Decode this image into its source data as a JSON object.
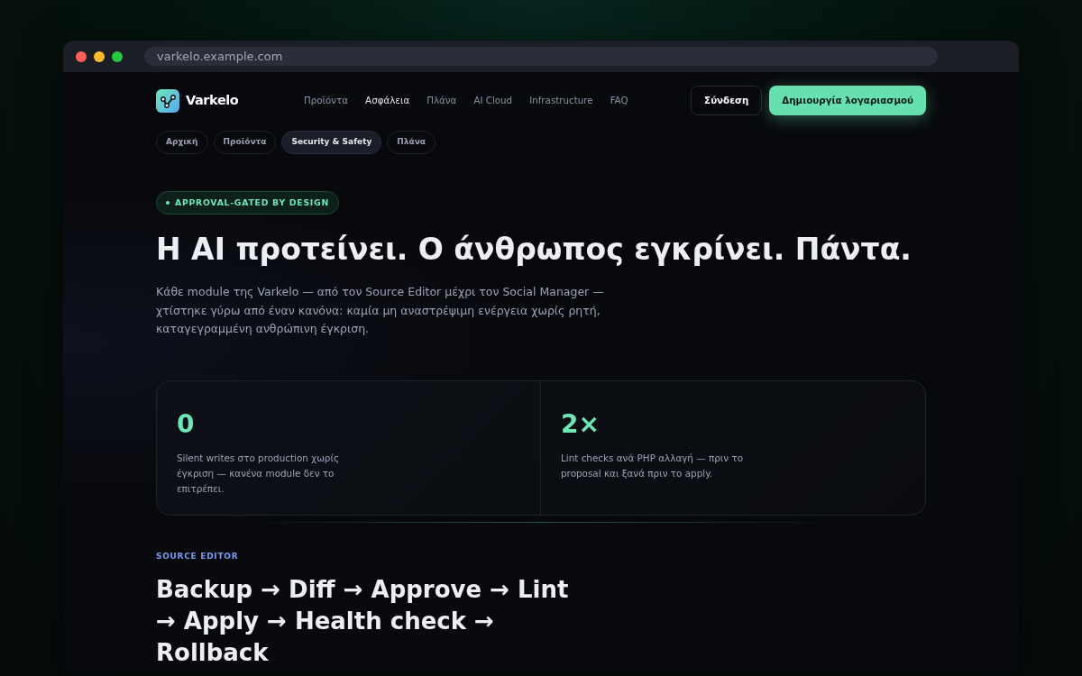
{
  "browser": {
    "url": "varkelo.example.com"
  },
  "header": {
    "brand": "Varkelo",
    "nav": [
      {
        "label": "Προϊόντα",
        "selected": false
      },
      {
        "label": "Ασφάλεια",
        "selected": true
      },
      {
        "label": "Πλάνα",
        "selected": false
      },
      {
        "label": "AI Cloud",
        "selected": false
      },
      {
        "label": "Infrastructure",
        "selected": false
      },
      {
        "label": "FAQ",
        "selected": false
      }
    ],
    "buttons": [
      {
        "label": "Σύνδεση",
        "kind": "secondary"
      },
      {
        "label": "Δημιουργία λογαριασμού",
        "kind": "primary"
      }
    ]
  },
  "breadcrumbs": [
    {
      "label": "Αρχική",
      "selected": false
    },
    {
      "label": "Προϊόντα",
      "selected": false
    },
    {
      "label": "Security & Safety",
      "selected": true
    },
    {
      "label": "Πλάνα",
      "selected": false
    }
  ],
  "hero": {
    "badge": "APPROVAL-GATED BY DESIGN",
    "title": "Η AI προτείνει. Ο άνθρωπος εγκρίνει. Πάντα.",
    "description": "Κάθε module της Varkelo — από τον Source Editor μέχρι τον Social Manager — χτίστηκε γύρω από έναν κανόνα: καμία μη αναστρέψιμη ενέργεια χωρίς ρητή, καταγεγραμμένη ανθρώπινη έγκριση."
  },
  "stats": [
    {
      "value": "0",
      "description": "Silent writes στο production χωρίς έγκριση — κανένα module δεν το επιτρέπει."
    },
    {
      "value": "2×",
      "description": "Lint checks ανά PHP αλλαγή — πριν το proposal και ξανά πριν το apply."
    }
  ],
  "section": {
    "eyebrow": "SOURCE EDITOR",
    "title": "Backup → Diff → Approve → Lint → Apply → Health check → Rollback"
  }
}
